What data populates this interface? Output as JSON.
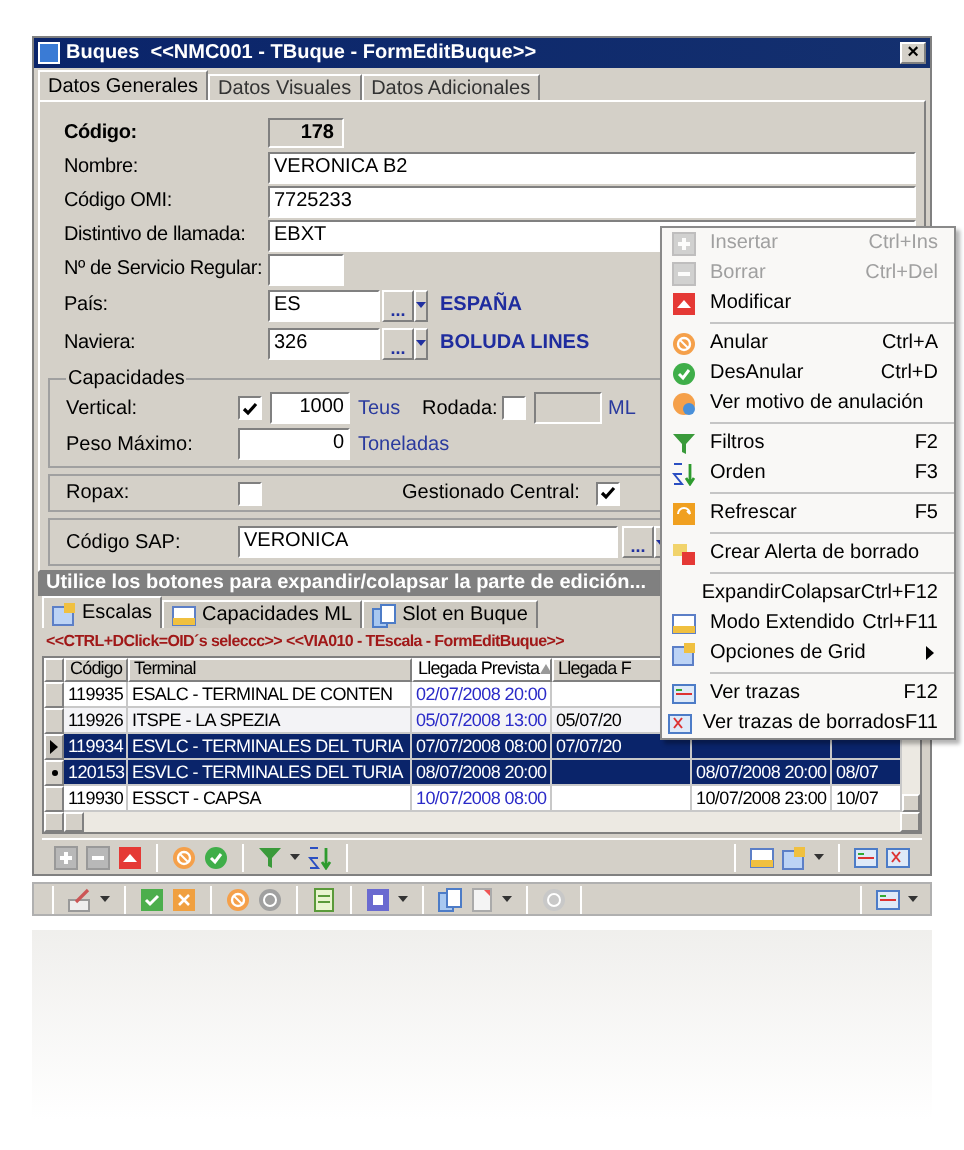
{
  "window": {
    "title": "Buques  <<NMC001 - TBuque - FormEditBuque>>",
    "close": "×"
  },
  "tabs": [
    {
      "label": "Datos Generales",
      "selected": true
    },
    {
      "label": "Datos Visuales",
      "selected": false
    },
    {
      "label": "Datos Adicionales",
      "selected": false
    }
  ],
  "fields": [
    {
      "kind": "readonly",
      "label": "Código:",
      "value": "178"
    },
    {
      "kind": "text",
      "label": "Nombre:",
      "value": "VERONICA B2"
    },
    {
      "kind": "text",
      "label": "Código OMI:",
      "value": "7725233"
    },
    {
      "kind": "text",
      "label": "Distintivo de llamada:",
      "value": "EBXT"
    },
    {
      "kind": "short",
      "label": "Nº de Servicio Regular:"
    },
    {
      "kind": "lookup",
      "label": "País:",
      "value": "ES",
      "button": "...",
      "description": "ESPAÑA"
    },
    {
      "kind": "lookup",
      "label": "Naviera:",
      "value": "326",
      "button": "...",
      "description": "BOLUDA LINES"
    }
  ],
  "capacidades": {
    "title": "Capacidades",
    "vertical": {
      "label": "Vertical:",
      "checked": true,
      "value": "1000",
      "unit": "Teus"
    },
    "rodada": {
      "label": "Rodada:",
      "checked": false,
      "disabled": true,
      "unit": "ML"
    },
    "peso": {
      "label": "Peso Máximo:",
      "value": "0",
      "unit": "Toneladas"
    }
  },
  "flags": [
    {
      "label": "Ropax:",
      "checked": false
    },
    {
      "label": "Gestionado Central:",
      "checked": true
    }
  ],
  "sap": {
    "label": "Código SAP:",
    "value": "VERONICA",
    "button": "..."
  },
  "hint": "Utilice los botones para expandir/colapsar la parte de edición...",
  "detail_tabs": [
    {
      "label": "Escalas",
      "selected": true
    },
    {
      "label": "Capacidades ML",
      "selected": false
    },
    {
      "label": "Slot en Buque",
      "selected": false
    }
  ],
  "caption": "<<CTRL+DClick=OID´s seleccc>> <<VIA010 - TEscala - FormEditBuque>>",
  "grid": {
    "columns": [
      {
        "label": "Código",
        "sorted": false
      },
      {
        "label": "Terminal",
        "sorted": false
      },
      {
        "label": "Llegada Prevista",
        "sorted": true
      },
      {
        "label": "Llegada F",
        "sorted": false
      }
    ],
    "rows": [
      {
        "selected": false,
        "current": false,
        "marked": false,
        "cells": [
          "119935",
          "ESALC - TERMINAL DE CONTEN",
          "02/07/2008 20:00",
          null,
          null,
          null
        ]
      },
      {
        "selected": false,
        "current": false,
        "marked": false,
        "cells": [
          "119926",
          "ITSPE - LA SPEZIA",
          "05/07/2008 13:00",
          "05/07/20",
          null,
          null
        ]
      },
      {
        "selected": true,
        "current": true,
        "marked": false,
        "cells": [
          "119934",
          "ESVLC - TERMINALES DEL TURIA",
          "07/07/2008 08:00",
          "07/07/20",
          null,
          null
        ]
      },
      {
        "selected": true,
        "current": false,
        "marked": true,
        "cells": [
          "120153",
          "ESVLC - TERMINALES DEL TURIA",
          "08/07/2008 20:00",
          null,
          "08/07/2008 20:00",
          "08/07"
        ]
      },
      {
        "selected": false,
        "current": false,
        "marked": false,
        "cells": [
          "119930",
          "ESSCT - CAPSA",
          "10/07/2008 08:00",
          null,
          "10/07/2008 23:00",
          "10/07"
        ]
      }
    ]
  },
  "menu": [
    {
      "kind": "item",
      "label": "Insertar",
      "shortcut": "Ctrl+Ins",
      "disabled": true
    },
    {
      "kind": "item",
      "label": "Borrar",
      "shortcut": "Ctrl+Del",
      "disabled": true
    },
    {
      "kind": "item",
      "label": "Modificar",
      "disabled": false
    },
    {
      "kind": "separator"
    },
    {
      "kind": "item",
      "label": "Anular",
      "shortcut": "Ctrl+A",
      "disabled": false
    },
    {
      "kind": "item",
      "label": "DesAnular",
      "shortcut": "Ctrl+D",
      "disabled": false
    },
    {
      "kind": "item",
      "label": "Ver motivo de anulación",
      "disabled": false
    },
    {
      "kind": "separator"
    },
    {
      "kind": "item",
      "label": "Filtros",
      "shortcut": "F2",
      "disabled": false
    },
    {
      "kind": "item",
      "label": "Orden",
      "shortcut": "F3",
      "disabled": false
    },
    {
      "kind": "separator"
    },
    {
      "kind": "item",
      "label": "Refrescar",
      "shortcut": "F5",
      "disabled": false
    },
    {
      "kind": "separator"
    },
    {
      "kind": "item",
      "label": "Crear Alerta de borrado",
      "disabled": false
    },
    {
      "kind": "separator"
    },
    {
      "kind": "item",
      "label": "ExpandirColapsar",
      "shortcut": "Ctrl+F12",
      "disabled": false
    },
    {
      "kind": "item",
      "label": "Modo Extendido",
      "shortcut": "Ctrl+F11",
      "disabled": false
    },
    {
      "kind": "item",
      "label": "Opciones de Grid",
      "submenu": true,
      "disabled": false
    },
    {
      "kind": "separator"
    },
    {
      "kind": "item",
      "label": "Ver trazas",
      "shortcut": "F12",
      "disabled": false
    },
    {
      "kind": "item",
      "label": "Ver trazas de borrados",
      "shortcut": "F11",
      "disabled": false
    }
  ]
}
